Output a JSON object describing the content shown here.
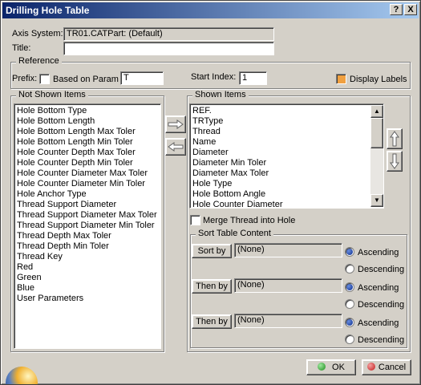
{
  "window": {
    "title": "Drilling Hole Table",
    "help_glyph": "?",
    "close_glyph": "X"
  },
  "axis_system": {
    "label": "Axis System:",
    "value": "TR01.CATPart: (Default)"
  },
  "title_field": {
    "label": "Title:",
    "value": ""
  },
  "reference": {
    "group_title": "Reference",
    "prefix_label": "Prefix:",
    "based_on_param_label": "Based on Param",
    "based_on_param_checked": false,
    "prefix_value": "T",
    "start_index_label": "Start Index:",
    "start_index_value": "1",
    "display_labels_label": "Display Labels",
    "display_labels_checked": true
  },
  "not_shown": {
    "group_title": "Not Shown Items",
    "items": [
      "Hole Bottom Type",
      "Hole Bottom Length",
      "Hole Bottom Length Max Toler",
      "Hole Bottom Length Min Toler",
      "Hole Counter Depth Max Toler",
      "Hole Counter Depth Min Toler",
      "Hole Counter Diameter Max Toler",
      "Hole Counter Diameter Min Toler",
      "Hole Anchor Type",
      "Thread Support Diameter",
      "Thread Support Diameter Max Toler",
      "Thread Support Diameter Min Toler",
      "Thread Depth Max Toler",
      "Thread Depth Min Toler",
      "Thread Key",
      "Red",
      "Green",
      "Blue",
      "User Parameters"
    ]
  },
  "shown": {
    "group_title": "Shown Items",
    "items": [
      "REF.",
      "TRType",
      "Thread",
      "Name",
      "Diameter",
      "Diameter Min Toler",
      "Diameter Max Toler",
      "Hole Type",
      "Hole Bottom Angle",
      "Hole Counter Diameter"
    ],
    "merge_thread_label": "Merge Thread into Hole",
    "merge_thread_checked": false
  },
  "sort": {
    "group_title": "Sort Table Content",
    "rows": [
      {
        "button": "Sort by",
        "value": "(None)",
        "ascending": "Ascending",
        "descending": "Descending",
        "selected": "ascending"
      },
      {
        "button": "Then by",
        "value": "(None)",
        "ascending": "Ascending",
        "descending": "Descending",
        "selected": "ascending"
      },
      {
        "button": "Then by",
        "value": "(None)",
        "ascending": "Ascending",
        "descending": "Descending",
        "selected": "ascending"
      }
    ]
  },
  "buttons": {
    "ok": "OK",
    "cancel": "Cancel"
  },
  "colors": {
    "titlebar_start": "#0a246a",
    "titlebar_end": "#a6caf0",
    "ok_icon": "#2ea82e",
    "cancel_icon": "#d43030",
    "display_labels_check": "#e8902a"
  }
}
